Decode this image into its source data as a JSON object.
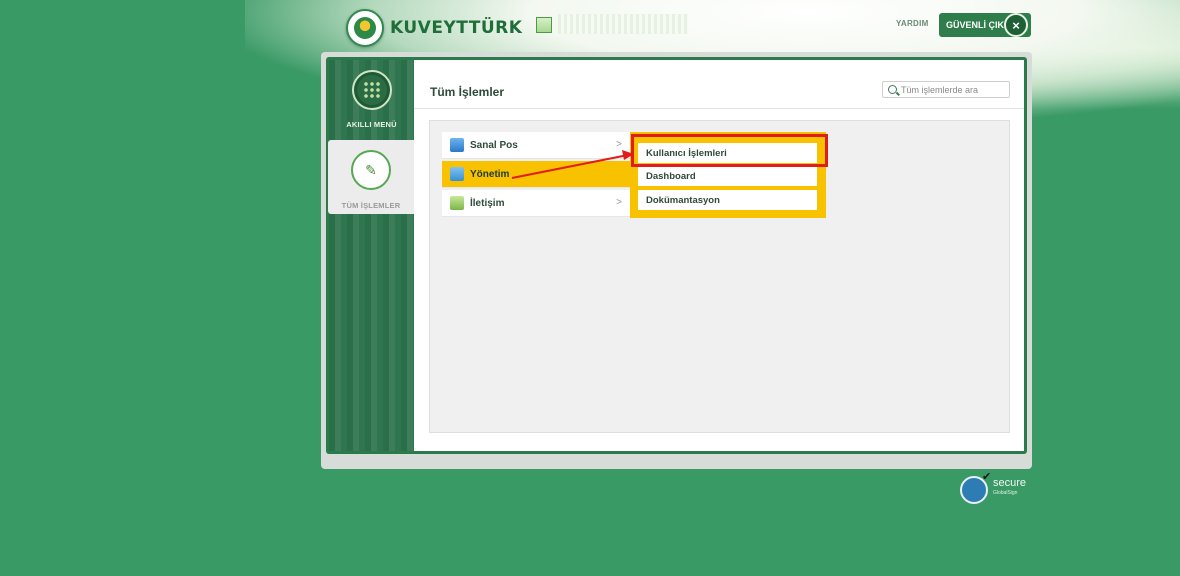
{
  "header": {
    "logo_text": "KUVEYTTÜRK",
    "help_label": "YARDIM",
    "logout_label": "GÜVENLİ ÇIKIŞ",
    "logout_icon": "close-icon"
  },
  "sidebar": {
    "items": [
      {
        "label": "AKILLI MENÜ",
        "icon": "grid-icon"
      },
      {
        "label": "TÜM İŞLEMLER",
        "icon": "edit-icon",
        "selected": true
      }
    ]
  },
  "main": {
    "title": "Tüm İşlemler",
    "search_placeholder": "Tüm işlemlerde ara",
    "menu": [
      {
        "label": "Sanal Pos",
        "icon": "cart-icon",
        "has_children": true
      },
      {
        "label": "Yönetim",
        "icon": "admin-icon",
        "active": true
      },
      {
        "label": "İletişim",
        "icon": "contact-icon",
        "has_children": true
      }
    ],
    "submenu": [
      {
        "label": "Kullanıcı İşlemleri",
        "highlighted": true
      },
      {
        "label": "Dashboard"
      },
      {
        "label": "Dokümantasyon"
      }
    ]
  },
  "footer": {
    "secure_label": "secure",
    "secure_sub": "GlobalSign"
  },
  "colors": {
    "background": "#3a9a66",
    "accent_yellow": "#f8c200",
    "highlight_red": "#e21b1b",
    "brand_green": "#2e7d4a"
  }
}
